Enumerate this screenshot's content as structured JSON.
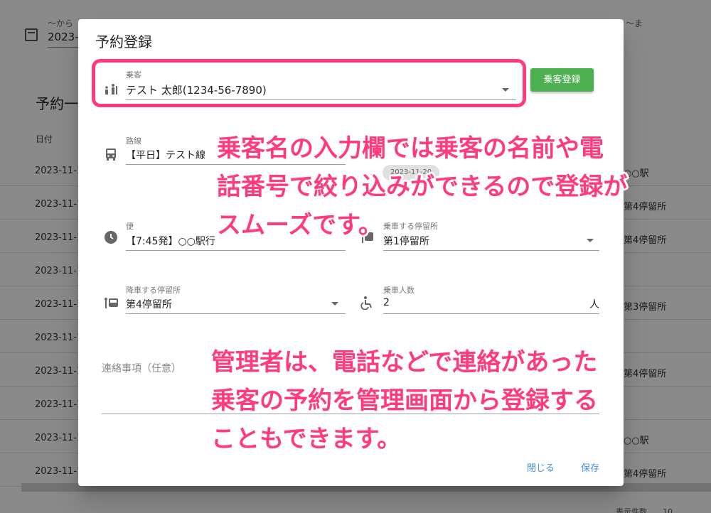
{
  "background": {
    "from_label": "〜から",
    "from_value": "2023-1",
    "to_label": "〜ま",
    "list_title": "予約一覧",
    "column_date": "日付",
    "rows": [
      {
        "date": "2023-11-1",
        "stop": "○○駅"
      },
      {
        "date": "2023-11-1",
        "stop": "第4停留所"
      },
      {
        "date": "2023-11-1",
        "stop": "第4停留所"
      },
      {
        "date": "2023-11-1",
        "stop": ""
      },
      {
        "date": "2023-11-1",
        "stop": "第3停留所"
      },
      {
        "date": "2023-11-1",
        "stop": ""
      },
      {
        "date": "2023-11-1",
        "stop": "第4停留所"
      },
      {
        "date": "2023-11-1",
        "stop": ""
      },
      {
        "date": "2023-11-1",
        "stop": "○○駅"
      },
      {
        "date": "2023-11-1",
        "stop": "第4停留所"
      }
    ],
    "footer": "表示件数　　10"
  },
  "dialog": {
    "title": "予約登録",
    "passenger": {
      "label": "乗客",
      "value": "テスト 太郎(1234-56-7890)"
    },
    "register_button": "乗客登録",
    "route": {
      "label": "路線",
      "value": "【平日】テスト線"
    },
    "date_chip": "2023-11-20",
    "trip": {
      "label": "便",
      "value": "【7:45発】○○駅行"
    },
    "boarding_stop": {
      "label": "乗車する停留所",
      "value": "第1停留所"
    },
    "alighting_stop": {
      "label": "降車する停留所",
      "value": "第4停留所"
    },
    "passenger_count": {
      "label": "乗車人数",
      "value": "2",
      "unit": "人"
    },
    "notes": {
      "label": "連絡事項（任意）"
    },
    "close_button": "閉じる",
    "save_button": "保存"
  },
  "annotations": {
    "top_lines": [
      "乗客名の入力欄では乗客の名前や電",
      "話番号で絞り込みができるので登録が",
      "スムーズです。"
    ],
    "bottom_lines": [
      "管理者は、電話などで連絡があった",
      "乗客の予約を管理画面から登録する",
      "こともできます。"
    ]
  },
  "colors": {
    "accent_pink": "#ff3b7f",
    "button_green": "#4caf50",
    "link_blue": "#4a8fd8"
  }
}
